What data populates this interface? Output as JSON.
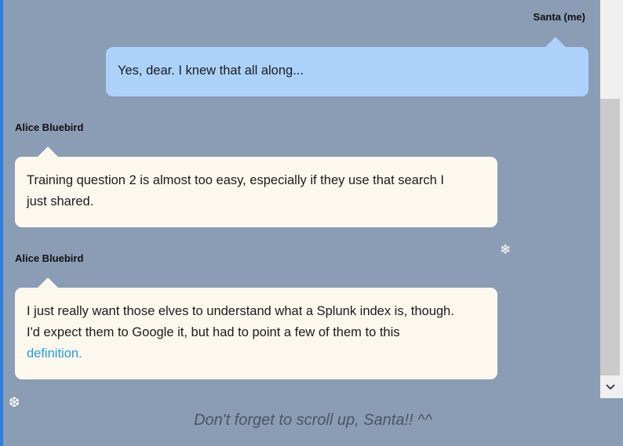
{
  "messages": [
    {
      "sender": "Santa (me)",
      "text": "Yes, dear. I knew that all along..."
    },
    {
      "sender": "Alice Bluebird",
      "lines": [
        "Training question 2 is almost too easy, especially if they use that search I",
        "just shared."
      ]
    },
    {
      "sender": "Alice Bluebird",
      "lines": [
        "I just really want those elves to understand what a Splunk index is, though.",
        "I'd expect them to Google it, but had to point a few of them to this"
      ],
      "link_text": "definition."
    }
  ],
  "footer_note": "Don't forget to scroll up, Santa!! ^^",
  "icons": {
    "snowflake": "snowflake-icon",
    "scroll_down": "chevron-down-icon"
  },
  "colors": {
    "background": "#8a9db5",
    "my_bubble": "#acd2fb",
    "their_bubble": "#fcf8ed",
    "link": "#2a9be0",
    "left_accent": "#2d7fe0"
  }
}
